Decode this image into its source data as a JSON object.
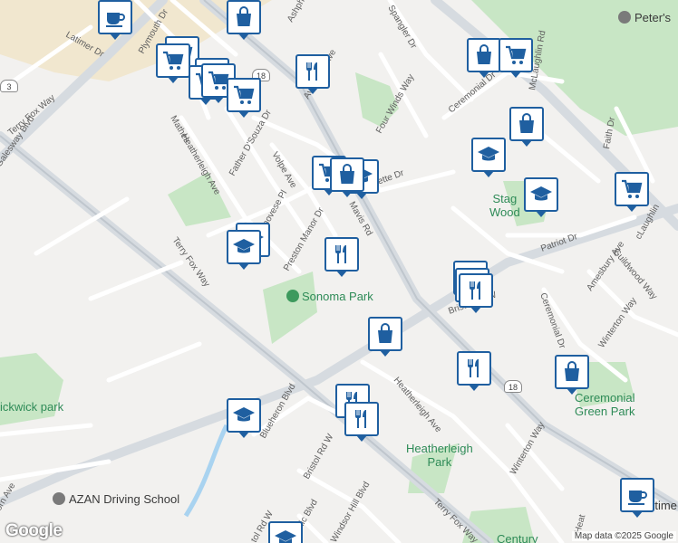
{
  "map": {
    "parks": [
      {
        "name": "Sonoma Park",
        "icon": "tree-icon"
      },
      {
        "name": "Heatherleigh\nPark"
      },
      {
        "name": "Ceremonial\nGreen Park"
      },
      {
        "name": "Stag\nWood"
      },
      {
        "name": "ickwick park"
      }
    ],
    "places": [
      {
        "name": "AZAN Driving School",
        "icon": "place-icon"
      },
      {
        "name": "Peter's",
        "icon": "place-icon"
      },
      {
        "name": "Century"
      },
      {
        "name": "rtime"
      }
    ],
    "streets": [
      "Latimer Dr",
      "Plymouth Dr",
      "Terry Fox Way",
      "Galesway Blvd",
      "Heatherleigh Ave",
      "Father D'Souza Dr",
      "Volpe Ave",
      "Genovese Pl",
      "Preston Manor Dr",
      "Mavis Rd",
      "Lafayette Dr",
      "Four Winds Way",
      "Spangler Dr",
      "Ceremonial Dr",
      "McLaughlin Rd",
      "Faith Dr",
      "Patriot Dr",
      "Guildwood Way",
      "Amesbury Ave",
      "Winterton Way",
      "Bristol Rd W",
      "Blueheron Blvd",
      "Windsor Hill Blvd",
      "Lismic Blvd",
      "Ashph",
      "Avonwick Ave",
      "Mathes",
      "orn Ave",
      "Heat",
      "tol Rd W",
      "cLaughlin"
    ],
    "shields": [
      "3",
      "18",
      "18"
    ],
    "attribution": "Map data ©2025 Google",
    "logo": "Google"
  },
  "colors": {
    "pin_border": "#1f5fa0",
    "park": "#c8e6c5",
    "park_label": "#2e8b57",
    "road_major": "#d6dbe0",
    "road_minor": "#ffffff",
    "urban_tan": "#f1e7cf"
  }
}
